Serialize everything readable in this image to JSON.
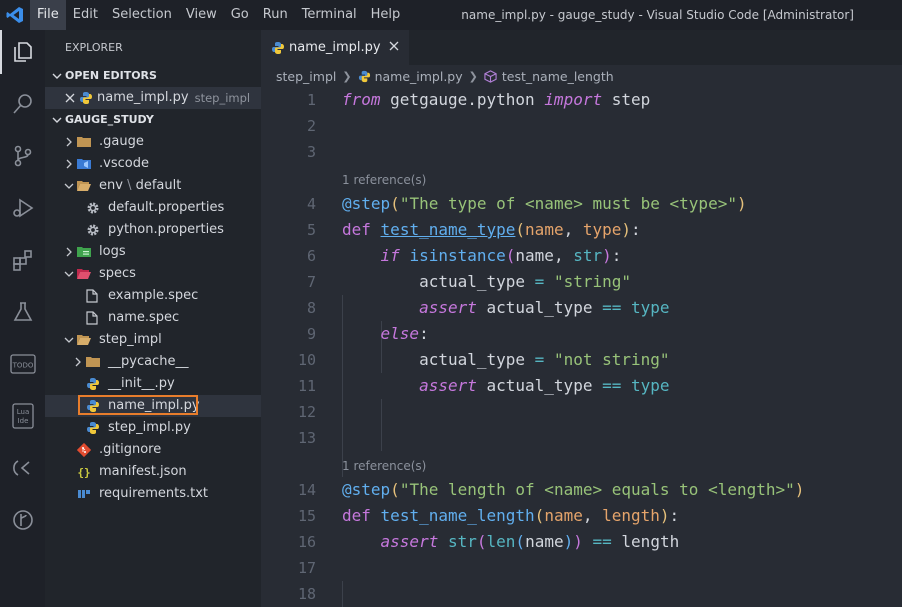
{
  "menu": [
    "File",
    "Edit",
    "Selection",
    "View",
    "Go",
    "Run",
    "Terminal",
    "Help"
  ],
  "window_title": "name_impl.py - gauge_study - Visual Studio Code [Administrator]",
  "sidebar": {
    "title": "EXPLORER",
    "open_editors": {
      "header": "OPEN EDITORS",
      "items": [
        {
          "name": "name_impl.py",
          "folder": "step_impl"
        }
      ]
    },
    "project": {
      "header": "GAUGE_STUDY",
      "tree": [
        {
          "label": ".gauge",
          "depth": 0,
          "type": "folder",
          "expanded": false,
          "icon": "folder-icon"
        },
        {
          "label": ".vscode",
          "depth": 0,
          "type": "folder",
          "expanded": false,
          "icon": "vscode-folder-icon"
        },
        {
          "label": "env",
          "label2": "default",
          "depth": 0,
          "type": "folder",
          "expanded": true,
          "icon": "folder-open-icon"
        },
        {
          "label": "default.properties",
          "depth": 1,
          "type": "file",
          "icon": "gear-icon"
        },
        {
          "label": "python.properties",
          "depth": 1,
          "type": "file",
          "icon": "gear-icon"
        },
        {
          "label": "logs",
          "depth": 0,
          "type": "folder",
          "expanded": false,
          "icon": "logs-folder-icon"
        },
        {
          "label": "specs",
          "depth": 0,
          "type": "folder",
          "expanded": true,
          "icon": "specs-folder-icon"
        },
        {
          "label": "example.spec",
          "depth": 1,
          "type": "file",
          "icon": "file-icon"
        },
        {
          "label": "name.spec",
          "depth": 1,
          "type": "file",
          "icon": "file-icon"
        },
        {
          "label": "step_impl",
          "depth": 0,
          "type": "folder",
          "expanded": true,
          "icon": "folder-open-icon"
        },
        {
          "label": "__pycache__",
          "depth": 1,
          "type": "folder",
          "expanded": false,
          "icon": "folder-icon"
        },
        {
          "label": "__init__.py",
          "depth": 1,
          "type": "file",
          "icon": "python-icon"
        },
        {
          "label": "name_impl.py",
          "depth": 1,
          "type": "file",
          "icon": "python-icon",
          "selected": true
        },
        {
          "label": "step_impl.py",
          "depth": 1,
          "type": "file",
          "icon": "python-icon"
        },
        {
          "label": ".gitignore",
          "depth": 0,
          "type": "file",
          "icon": "git-icon"
        },
        {
          "label": "manifest.json",
          "depth": 0,
          "type": "file",
          "icon": "json-icon"
        },
        {
          "label": "requirements.txt",
          "depth": 0,
          "type": "file",
          "icon": "pip-icon"
        }
      ]
    }
  },
  "editor": {
    "tab": "name_impl.py",
    "breadcrumbs": [
      "step_impl",
      "name_impl.py",
      "test_name_length"
    ],
    "reference_label": "1 reference(s)",
    "line_numbers": [
      "1",
      "2",
      "3",
      "4",
      "5",
      "6",
      "7",
      "8",
      "9",
      "10",
      "11",
      "12",
      "13",
      "14",
      "15",
      "16",
      "17",
      "18"
    ]
  },
  "colors": {
    "accent": "#61afef",
    "selection_outline": "#e87d2c",
    "keyword": "#c678dd",
    "string": "#98c379",
    "parameter": "#e5a46b",
    "builtin": "#56b6c2"
  }
}
